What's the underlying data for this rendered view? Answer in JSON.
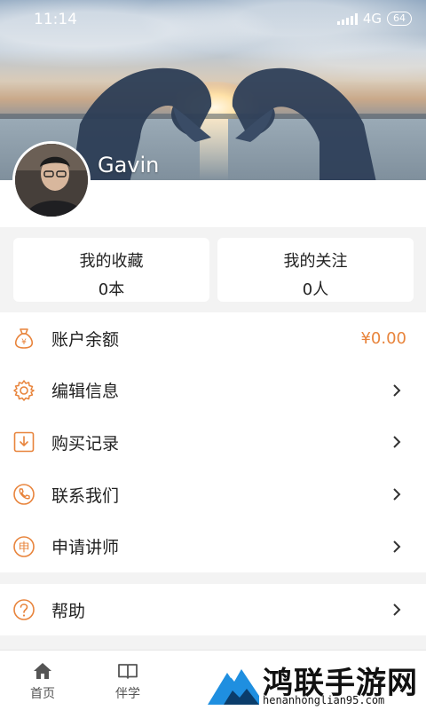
{
  "status_bar": {
    "time": "11:14",
    "network": "4G",
    "battery": "64"
  },
  "profile": {
    "username": "Gavin"
  },
  "stats": [
    {
      "title": "我的收藏",
      "value": "0本"
    },
    {
      "title": "我的关注",
      "value": "0人"
    }
  ],
  "menu": {
    "balance": {
      "label": "账户余额",
      "amount": "¥0.00",
      "icon": "money-bag-icon"
    },
    "items": [
      {
        "label": "编辑信息",
        "icon": "gear-icon"
      },
      {
        "label": "购买记录",
        "icon": "download-box-icon"
      },
      {
        "label": "联系我们",
        "icon": "phone-icon"
      },
      {
        "label": "申请讲师",
        "icon": "apply-icon"
      }
    ],
    "help": {
      "label": "帮助",
      "icon": "question-icon"
    }
  },
  "bottom_nav": [
    {
      "label": "首页",
      "icon": "home-icon"
    },
    {
      "label": "伴学",
      "icon": "book-icon"
    }
  ],
  "watermark": {
    "text": "鸿联手游网",
    "url": "henanhonglian95.com"
  },
  "colors": {
    "accent": "#e8843c",
    "text": "#222222",
    "background": "#f3f3f3"
  }
}
